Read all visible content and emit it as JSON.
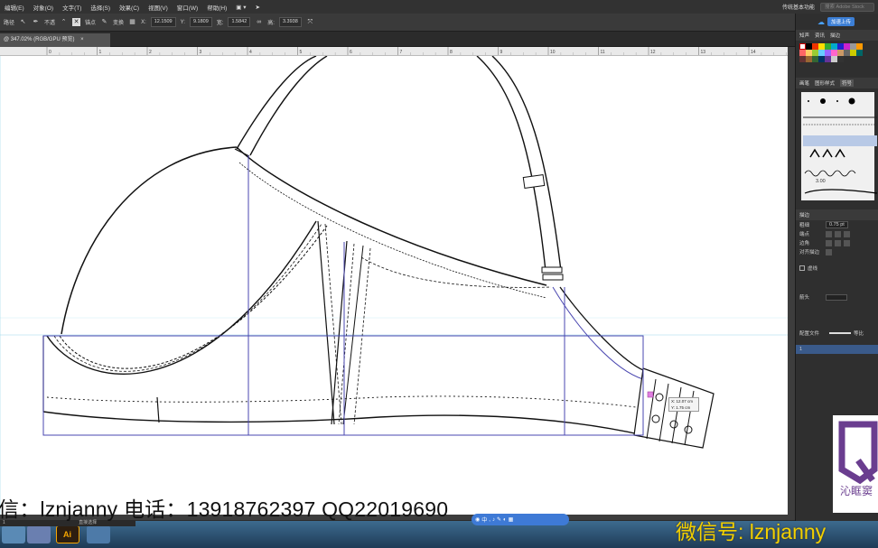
{
  "menubar": {
    "items": [
      "编辑(E)",
      "对象(O)",
      "文字(T)",
      "选择(S)",
      "效果(C)",
      "视图(V)",
      "窗口(W)",
      "帮助(H)"
    ],
    "workspace": "传统基本功能",
    "search_placeholder": "搜索 Adobe Stock"
  },
  "options_bar": {
    "path_label": "路径",
    "stroke_label": "不透",
    "anchor_label": "锚点",
    "transform_label": "变换",
    "x_value": "12.1509",
    "y_value": "9.1809",
    "w_value": "1.5842",
    "h_value": "3.3938"
  },
  "document_tab": {
    "title": "@ 347.02% (RGB/GPU 预览)",
    "close": "×"
  },
  "ruler": {
    "ticks": [
      "0",
      "1",
      "2",
      "3",
      "4",
      "5",
      "6",
      "7",
      "8",
      "9",
      "10",
      "11",
      "12",
      "13",
      "14"
    ]
  },
  "right_panel": {
    "cloud_button": "加速上传",
    "tabs1": [
      "知声",
      "资讯",
      "描边"
    ],
    "brush_tabs": [
      "画笔",
      "图形样式",
      "符号"
    ],
    "brush_size": "3.00",
    "stroke_section": "描边",
    "stroke_weight_label": "粗细",
    "stroke_weight": "0.75 pt",
    "cap_label": "端点",
    "corner_label": "边角",
    "align_label": "对齐描边",
    "dashed_label": "虚线",
    "arrow_label": "箭头",
    "profile_label": "配置文件",
    "profile_value": "等比",
    "layers_row": "1"
  },
  "tooltip": {
    "x": "X: 12.07 cm",
    "y": "Y: 1.75 cm"
  },
  "overlay": {
    "contact": "信：lznjanny 电话：13918762397 QQ22019690",
    "wechat": "微信号: lznjanny",
    "logo_text": "沁眶窦"
  },
  "statusbar": {
    "zoom": "1",
    "tool": "直接选择"
  },
  "colors": {
    "app_bg": "#2b2b2b",
    "canvas": "#ffffff",
    "guide": "#4a47b0",
    "wechat_text": "#f2d000",
    "taskbar": "#2a4c6d"
  }
}
